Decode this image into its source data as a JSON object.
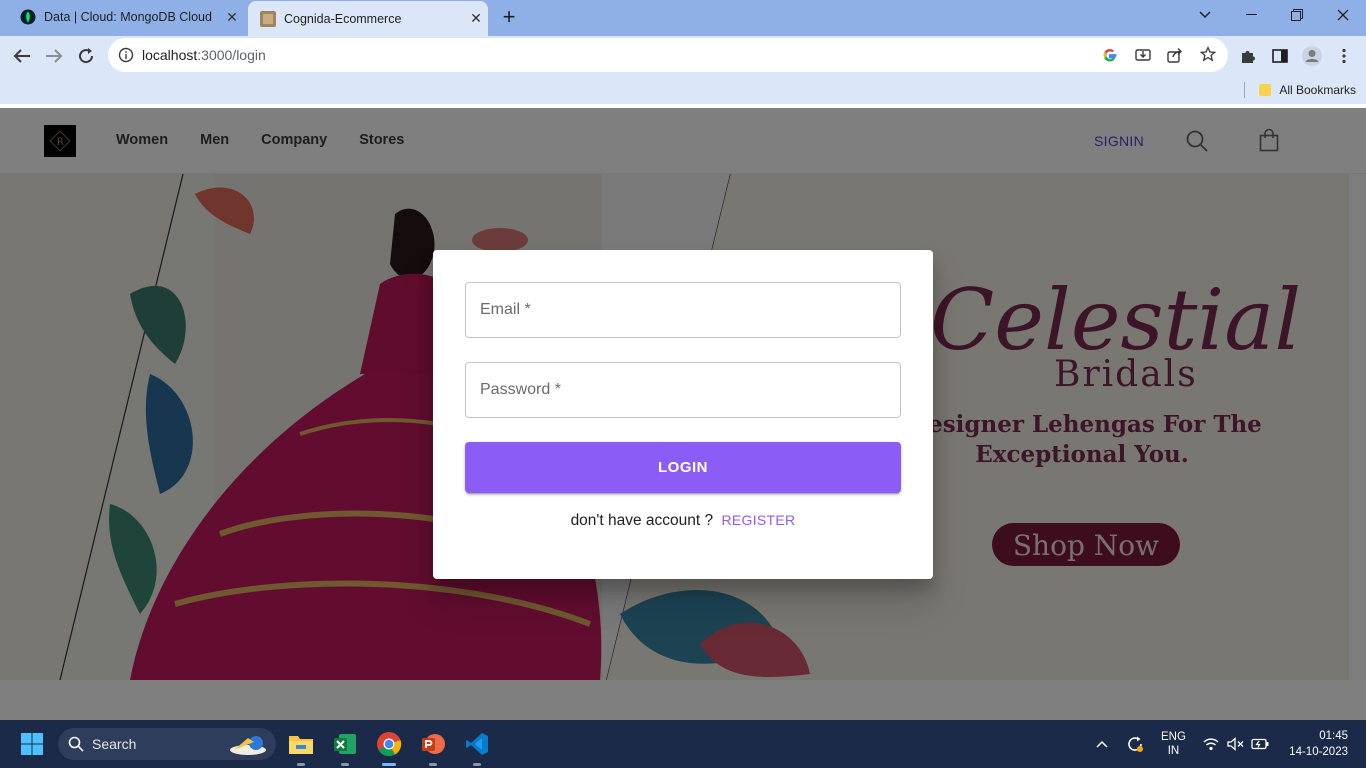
{
  "browser": {
    "tabs": [
      {
        "title": "Data | Cloud: MongoDB Cloud",
        "active": false
      },
      {
        "title": "Cognida-Ecommerce",
        "active": true
      }
    ],
    "url_host": "localhost",
    "url_rest": ":3000/login",
    "bookmarks_label": "All Bookmarks"
  },
  "site": {
    "nav_links": [
      "Women",
      "Men",
      "Company",
      "Stores"
    ],
    "signin_label": "SIGNIN"
  },
  "login_modal": {
    "email_placeholder": "Email *",
    "password_placeholder": "Password *",
    "login_button": "LOGIN",
    "no_account_text": "don't have account ?",
    "register_link": "REGISTER"
  },
  "hero": {
    "headline_script": "Celestial",
    "headline_caps": "Bridals",
    "tagline_line1": "Designer Lehengas For The",
    "tagline_line2": "Exceptional You.",
    "cta": "Shop Now"
  },
  "taskbar": {
    "search_label": "Search",
    "lang_line1": "ENG",
    "lang_line2": "IN",
    "time": "01:45",
    "date": "14-10-2023"
  },
  "colors": {
    "accent": "#8b5cf6",
    "signin": "#5145cd",
    "hero_text": "#7a2a52",
    "cta_bg": "#7a1a3a"
  }
}
